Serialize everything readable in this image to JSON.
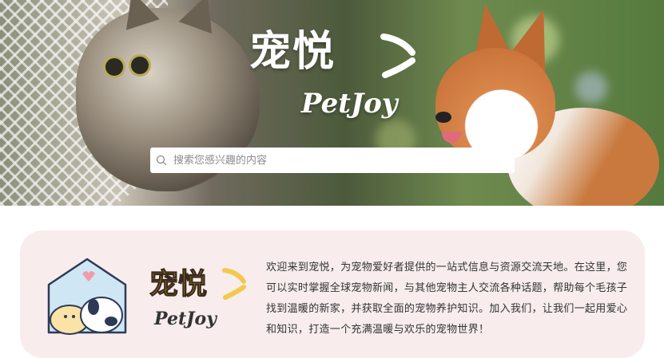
{
  "hero": {
    "brand_cn": "宠悦",
    "brand_en": "PetJoy",
    "search": {
      "placeholder": "搜索您感兴趣的内容",
      "value": ""
    }
  },
  "intro": {
    "logo_cn": "宠悦",
    "logo_en": "PetJoy",
    "text": "欢迎来到宠悦，为宠物爱好者提供的一站式信息与资源交流天地。在这里，您可以实时掌握全球宠物新闻，与其他宠物主人交流各种话题，帮助每个毛孩子找到温暖的新家，并获取全面的宠物养护知识。加入我们，让我们一起用爱心和知识，打造一个充满温暖与欢乐的宠物世界！"
  },
  "colors": {
    "intro_bg": "#f8ecec",
    "logo_yellow": "#f2c94c",
    "house_outline": "#2d3a55",
    "house_fill": "#cfe6f5",
    "heart": "#f39aa8"
  },
  "icons": [
    "search-icon",
    "house-logo-icon",
    "swoosh-icon"
  ]
}
